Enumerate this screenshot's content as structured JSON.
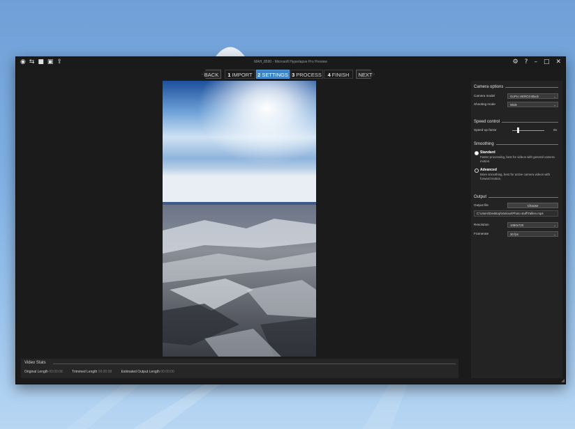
{
  "window": {
    "title": "MAH_8590 - Microsoft Hyperlapse Pro Preview",
    "titlebar_icons": [
      "app-icon",
      "share-icon",
      "folder-icon",
      "save-icon",
      "export-icon"
    ],
    "titlebar_controls": [
      "gear-icon",
      "help-icon",
      "minimize-icon",
      "maximize-icon",
      "close-icon"
    ]
  },
  "wizard": {
    "back_label": "BACK",
    "next_label": "NEXT",
    "steps": [
      {
        "number": "1",
        "label": "IMPORT"
      },
      {
        "number": "2",
        "label": "SETTINGS"
      },
      {
        "number": "3",
        "label": "PROCESS"
      },
      {
        "number": "4",
        "label": "FINISH"
      }
    ],
    "active_step": 1,
    "active_color": "#3b83c8"
  },
  "video_stats": {
    "title": "Video Stats",
    "items": [
      {
        "label": "Original Length",
        "value": "00:00:08"
      },
      {
        "label": "Trimmed Length",
        "value": "00:00:08"
      },
      {
        "label": "Estimated Output Length",
        "value": "00:00:00"
      }
    ]
  },
  "panel": {
    "camera_options": {
      "title": "Camera options",
      "camera_model_label": "Camera model",
      "camera_model_value": "GoPro HERO3 Black",
      "shooting_mode_label": "Shooting mode",
      "shooting_mode_value": "Wide"
    },
    "speed_control": {
      "title": "Speed control",
      "speedup_label": "Speed-up factor",
      "speedup_value": "8x",
      "slider_fraction": 0.18
    },
    "smoothing": {
      "title": "Smoothing",
      "options": [
        {
          "label": "Standard",
          "description": "Faster processing, best for videos with general camera motion.",
          "selected": true
        },
        {
          "label": "Advanced",
          "description": "More smoothing, best for active camera videos with forward motion.",
          "selected": false
        }
      ]
    },
    "output": {
      "title": "Output",
      "output_file_label": "Output file",
      "choose_label": "Choose",
      "output_path": "C:\\Users\\Desktop\\Various\\Photo stuff\\Tallinn.mp4",
      "resolution_label": "Resolution",
      "resolution_value": "1080x720",
      "framerate_label": "Framerate",
      "framerate_value": "30 fps"
    }
  },
  "colors": {
    "window_bg": "#1b1b1b",
    "panel_bg": "#232323",
    "desktop_top": "#6f9fd6",
    "desktop_bottom": "#b7d6f2"
  }
}
